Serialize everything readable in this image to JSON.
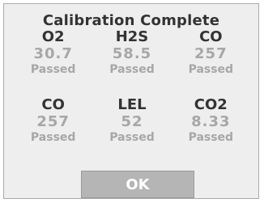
{
  "dialog": {
    "title": "Calibration Complete",
    "ok_label": "OK"
  },
  "sensors": [
    {
      "name": "O2",
      "value": "30.7",
      "status": "Passed"
    },
    {
      "name": "H2S",
      "value": "58.5",
      "status": "Passed"
    },
    {
      "name": "CO",
      "value": "257",
      "status": "Passed"
    },
    {
      "name": "CO",
      "value": "257",
      "status": "Passed"
    },
    {
      "name": "LEL",
      "value": "52",
      "status": "Passed"
    },
    {
      "name": "CO2",
      "value": "8.33",
      "status": "Passed"
    }
  ],
  "colors": {
    "panel_background": "#eeeeee",
    "heading_text": "#333333",
    "muted_text": "#a7a7a7",
    "button_background": "#b5b5b5"
  }
}
